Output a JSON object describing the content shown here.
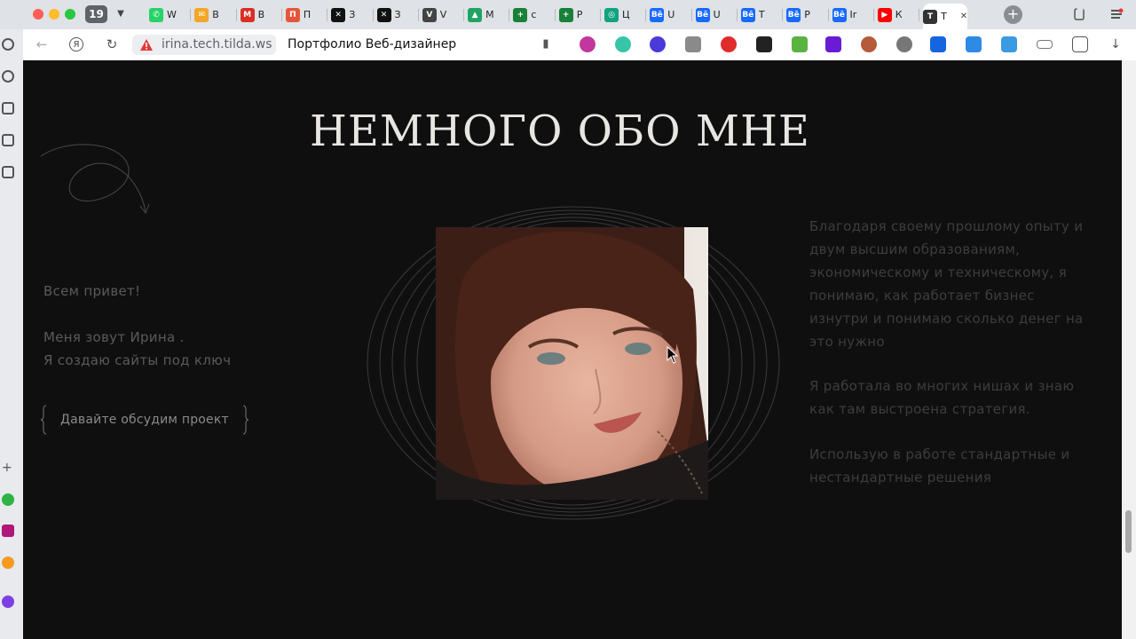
{
  "browser": {
    "tab_count": "19",
    "tabs": [
      {
        "label": "W",
        "icon": "whatsapp-icon",
        "color": "#25d366",
        "glyph": "✆"
      },
      {
        "label": "В",
        "icon": "mail-icon",
        "color": "#f4a62a",
        "glyph": "✉"
      },
      {
        "label": "В",
        "icon": "gmail-icon",
        "color": "#d93025",
        "glyph": "M"
      },
      {
        "label": "П",
        "icon": "p-app-icon",
        "color": "#e6553a",
        "glyph": "П"
      },
      {
        "label": "З",
        "icon": "x-icon",
        "color": "#111111",
        "glyph": "✕"
      },
      {
        "label": "З",
        "icon": "x-icon",
        "color": "#111111",
        "glyph": "✕"
      },
      {
        "label": "V",
        "icon": "v-icon",
        "color": "#444444",
        "glyph": "V"
      },
      {
        "label": "М",
        "icon": "drive-icon",
        "color": "#1fa463",
        "glyph": "▲"
      },
      {
        "label": "с",
        "icon": "sheets-icon",
        "color": "#188038",
        "glyph": "+"
      },
      {
        "label": "Р",
        "icon": "sheets-icon",
        "color": "#188038",
        "glyph": "+"
      },
      {
        "label": "Ц",
        "icon": "chatgpt-icon",
        "color": "#10a37f",
        "glyph": "◎"
      },
      {
        "label": "U",
        "icon": "behance-icon",
        "color": "#1769ff",
        "glyph": "Bē"
      },
      {
        "label": "U",
        "icon": "behance-icon",
        "color": "#1769ff",
        "glyph": "Bē"
      },
      {
        "label": "Т",
        "icon": "behance-icon",
        "color": "#1769ff",
        "glyph": "Bē"
      },
      {
        "label": "Р",
        "icon": "behance-icon",
        "color": "#1769ff",
        "glyph": "Bē"
      },
      {
        "label": "Ir",
        "icon": "behance-icon",
        "color": "#1769ff",
        "glyph": "Bē"
      },
      {
        "label": "К",
        "icon": "youtube-icon",
        "color": "#ff0000",
        "glyph": "▶"
      },
      {
        "label": "Т",
        "icon": "tilda-icon",
        "color": "#333333",
        "glyph": "T"
      }
    ],
    "active_tab_icon": "tilda-icon",
    "url": "irina.tech.tilda.ws",
    "page_title": "Портфолио Веб-дизайнер"
  },
  "page": {
    "heading": "НЕМНОГО ОБО МНЕ",
    "greeting": "Всем привет!",
    "name_line": "Меня зовут Ирина .",
    "subtitle_line": "Я создаю сайты под ключ",
    "cta_label": "Давайте обсудим проект",
    "right_p1": "Благодаря своему прошлому опыту и двум высшим образованиям, экономическому и техническому, я понимаю, как работает бизнес изнутри и понимаю сколько денег на это нужно",
    "right_p2": "Я работала во многих нишах и знаю как там выстроена стратегия.",
    "right_p3": "Использую в работе стандартные и нестандартные решения"
  },
  "colors": {
    "page_bg": "#0f0f10",
    "heading": "#e8e6e3",
    "left_text": "#5a5a5a",
    "right_text": "#3d3d3d"
  }
}
